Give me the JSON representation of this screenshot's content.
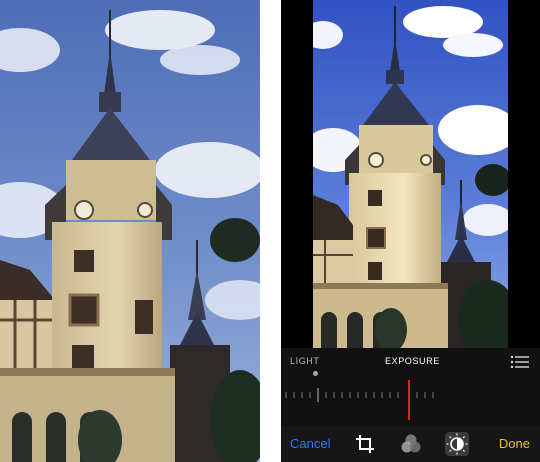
{
  "editor": {
    "slider_title": "EXPOSURE",
    "category_label": "LIGHT",
    "cancel_label": "Cancel",
    "done_label": "Done"
  },
  "icons": {
    "list": "list-icon",
    "crop": "crop-icon",
    "filters": "filters-icon",
    "adjust": "adjust-icon"
  },
  "colors": {
    "cancel": "#2f7bf5",
    "done": "#f0c419",
    "slider_marker": "#e0231e",
    "panel_bg": "#111111"
  }
}
